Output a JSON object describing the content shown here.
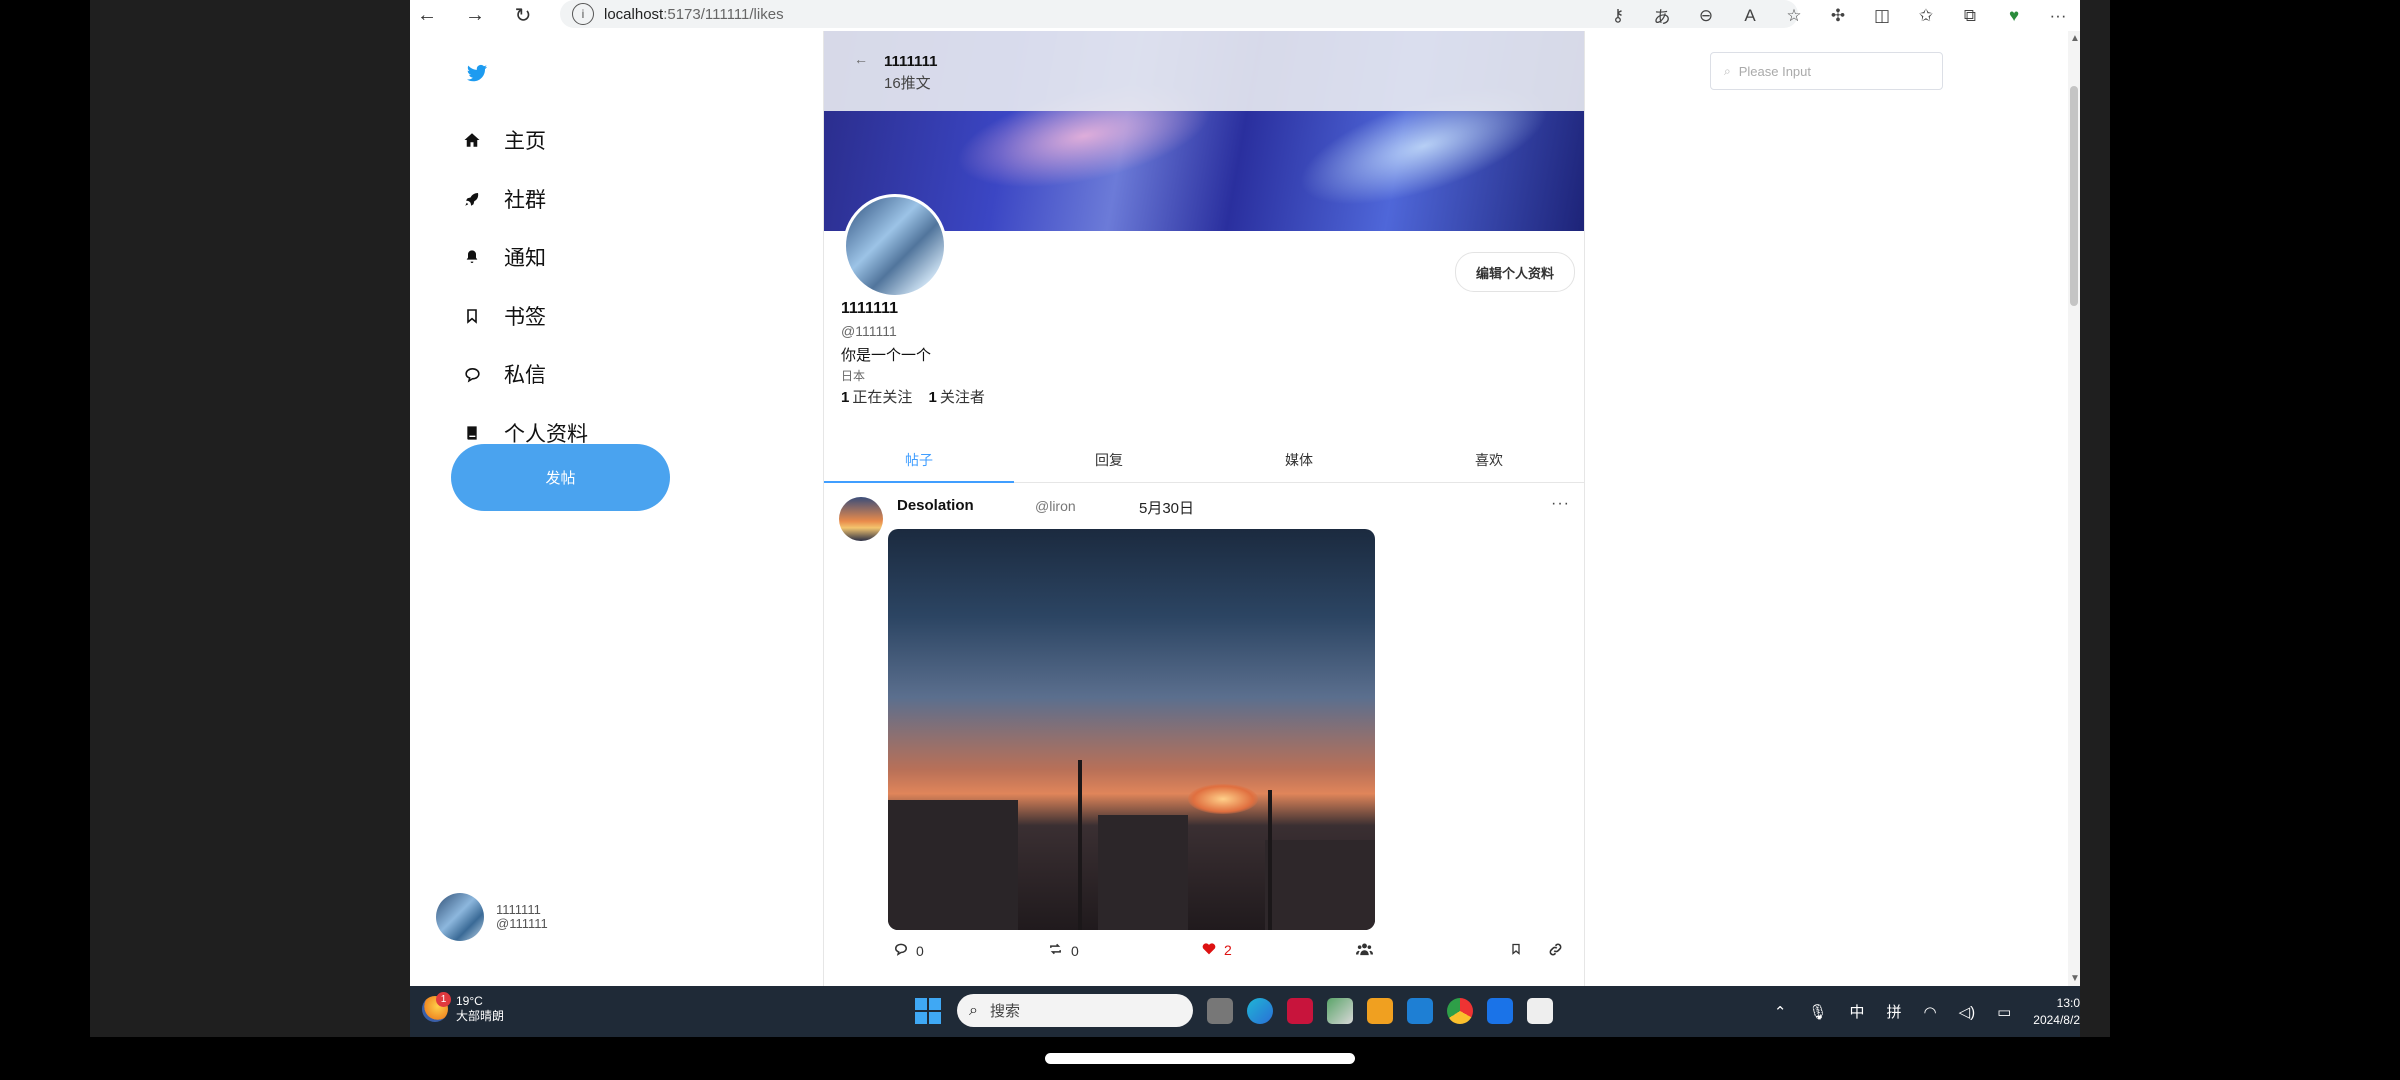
{
  "browser": {
    "url_host": "localhost",
    "url_rest": ":5173/111111/likes"
  },
  "sidebar": {
    "items": [
      {
        "label": "主页",
        "icon": "home-icon"
      },
      {
        "label": "社群",
        "icon": "rocket-icon"
      },
      {
        "label": "通知",
        "icon": "bell-icon"
      },
      {
        "label": "书签",
        "icon": "bookmark-icon"
      },
      {
        "label": "私信",
        "icon": "message-icon"
      },
      {
        "label": "个人资料",
        "icon": "profile-book-icon"
      }
    ],
    "post_button": "发帖",
    "user": {
      "name": "1111111",
      "handle": "@111111"
    }
  },
  "header": {
    "name": "1111111",
    "count": "16推文"
  },
  "profile": {
    "edit_button": "编辑个人资料",
    "name": "1111111",
    "handle": "@111111",
    "bio": "你是一个一个",
    "location": "日本",
    "following_count": "1",
    "following_label": "正在关注",
    "followers_count": "1",
    "followers_label": "关注者"
  },
  "tabs": [
    {
      "label": "帖子",
      "active": true
    },
    {
      "label": "回复",
      "active": false
    },
    {
      "label": "媒体",
      "active": false
    },
    {
      "label": "喜欢",
      "active": false
    }
  ],
  "post": {
    "author": "Desolation",
    "handle": "@liron",
    "date": "5月30日",
    "more": "···",
    "comments": "0",
    "retweets": "0",
    "likes": "2"
  },
  "search": {
    "placeholder": "Please Input"
  },
  "taskbar": {
    "temp": "19°C",
    "weather": "大部晴朗",
    "weather_badge": "1",
    "search_label": "搜索",
    "ime1": "中",
    "ime2": "拼",
    "time": "13:0",
    "date": "2024/8/2"
  },
  "colors": {
    "accent": "#409eff",
    "post_button": "#4aa3ef",
    "like": "#dd1111"
  }
}
